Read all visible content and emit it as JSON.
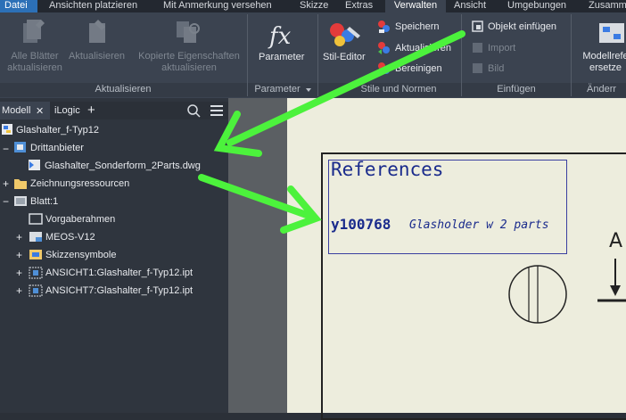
{
  "menu": {
    "items": [
      "Datei",
      "Ansichten platzieren",
      "Mit Anmerkung versehen",
      "Skizze",
      "Extras",
      "Verwalten",
      "Ansicht",
      "Umgebungen",
      "Zusamm"
    ],
    "active": "Verwalten"
  },
  "ribbon": {
    "aktualisieren": {
      "alle_blaetter": [
        "Alle Blätter",
        "aktualisieren"
      ],
      "aktualisieren": "Aktualisieren",
      "kopierte": [
        "Kopierte Eigenschaften",
        "aktualisieren"
      ],
      "group_label": "Aktualisieren"
    },
    "parameter": {
      "label": "Parameter",
      "group_label": "Parameter"
    },
    "stile": {
      "stil_editor": "Stil-Editor",
      "speichern": "Speichern",
      "aktualisieren": "Aktualisieren",
      "bereinigen": "Bereinigen",
      "group_label": "Stile und Normen"
    },
    "einfuegen": {
      "objekt_einfuegen": "Objekt einfügen",
      "import": "Import",
      "bild": "Bild",
      "group_label": "Einfügen"
    },
    "modell": {
      "label": [
        "Modellrefe",
        "ersetze"
      ],
      "group_label": "Änderr"
    }
  },
  "browser": {
    "tabs": {
      "modell": "Modell",
      "close": "✕",
      "ilogic": "iLogic",
      "add": "+"
    },
    "tree": {
      "root": "Glashalter_f-Typ12",
      "drittanbieter": "Drittanbieter",
      "dwg": "Glashalter_Sonderform_2Parts.dwg",
      "zeichnungsressourcen": "Zeichnungsressourcen",
      "blatt": "Blatt:1",
      "vorgaberahmen": "Vorgaberahmen",
      "meos": "MEOS-V12",
      "skizzensymbole": "Skizzensymbole",
      "ansicht1": "ANSICHT1:Glashalter_f-Typ12.ipt",
      "ansicht7": "ANSICHT7:Glashalter_f-Typ12.ipt"
    }
  },
  "drawing": {
    "references_title": "References",
    "ref_number": "y100768",
    "ref_desc": "Glasholder w 2 parts",
    "view_letter": "A"
  },
  "colors": {
    "accent": "#2c70b7",
    "arrow": "#4cf23c",
    "ref_text": "#1a2b8c"
  }
}
